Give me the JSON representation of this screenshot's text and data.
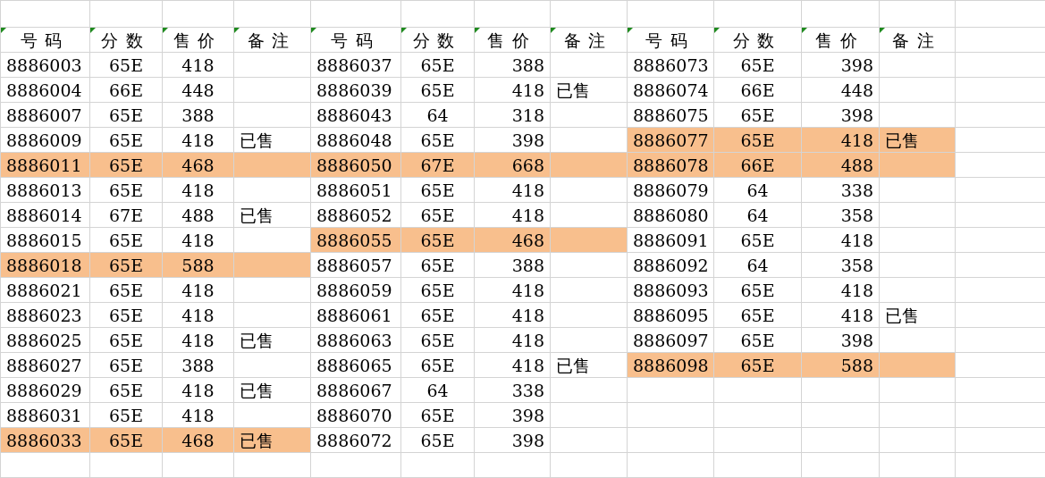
{
  "blocks": [
    {
      "columns": [
        {
          "label": "号码",
          "marked": true
        },
        {
          "label": "分数",
          "marked": true
        },
        {
          "label": "售价",
          "marked": true
        },
        {
          "label": "备注",
          "marked": true
        }
      ],
      "rows": [
        {
          "code": "8886003",
          "score": "65E",
          "price": "418",
          "highlighted": false
        },
        {
          "code": "8886004",
          "score": "66E",
          "price": "448",
          "highlighted": false
        },
        {
          "code": "8886007",
          "score": "65E",
          "price": "388",
          "highlighted": false
        },
        {
          "code": "8886009",
          "score": "65E",
          "price": "418",
          "note": "已售",
          "highlighted": false
        },
        {
          "code": "8886011",
          "score": "65E",
          "price": "468",
          "highlighted": true
        },
        {
          "code": "8886013",
          "score": "65E",
          "price": "418",
          "highlighted": false
        },
        {
          "code": "8886014",
          "score": "67E",
          "price": "488",
          "note": "已售",
          "highlighted": false
        },
        {
          "code": "8886015",
          "score": "65E",
          "price": "418",
          "highlighted": false
        },
        {
          "code": "8886018",
          "score": "65E",
          "price": "588",
          "highlighted": true
        },
        {
          "code": "8886021",
          "score": "65E",
          "price": "418",
          "highlighted": false
        },
        {
          "code": "8886023",
          "score": "65E",
          "price": "418",
          "highlighted": false
        },
        {
          "code": "8886025",
          "score": "65E",
          "price": "418",
          "note": "已售",
          "highlighted": false
        },
        {
          "code": "8886027",
          "score": "65E",
          "price": "388",
          "highlighted": false
        },
        {
          "code": "8886029",
          "score": "65E",
          "price": "418",
          "note": "已售",
          "highlighted": false
        },
        {
          "code": "8886031",
          "score": "65E",
          "price": "418",
          "highlighted": false
        },
        {
          "code": "8886033",
          "score": "65E",
          "price": "468",
          "note": "已售",
          "highlighted": true
        }
      ]
    },
    {
      "columns": [
        {
          "label": "号码",
          "marked": true
        },
        {
          "label": "分数",
          "marked": true
        },
        {
          "label": "售价",
          "marked": true
        },
        {
          "label": "备注",
          "marked": true
        }
      ],
      "rows": [
        {
          "code": "8886037",
          "score": "65E",
          "price": "388",
          "highlighted": false
        },
        {
          "code": "8886039",
          "score": "65E",
          "price": "418",
          "note": "已售",
          "highlighted": false
        },
        {
          "code": "8886043",
          "score": "64",
          "price": "318",
          "highlighted": false
        },
        {
          "code": "8886048",
          "score": "65E",
          "price": "398",
          "highlighted": false
        },
        {
          "code": "8886050",
          "score": "67E",
          "price": "668",
          "highlighted": true
        },
        {
          "code": "8886051",
          "score": "65E",
          "price": "418",
          "highlighted": false
        },
        {
          "code": "8886052",
          "score": "65E",
          "price": "418",
          "highlighted": false
        },
        {
          "code": "8886055",
          "score": "65E",
          "price": "468",
          "highlighted": true
        },
        {
          "code": "8886057",
          "score": "65E",
          "price": "388",
          "highlighted": false
        },
        {
          "code": "8886059",
          "score": "65E",
          "price": "418",
          "highlighted": false
        },
        {
          "code": "8886061",
          "score": "65E",
          "price": "418",
          "highlighted": false
        },
        {
          "code": "8886063",
          "score": "65E",
          "price": "418",
          "highlighted": false
        },
        {
          "code": "8886065",
          "score": "65E",
          "price": "418",
          "note": "已售",
          "highlighted": false
        },
        {
          "code": "8886067",
          "score": "64",
          "price": "338",
          "highlighted": false
        },
        {
          "code": "8886070",
          "score": "65E",
          "price": "398",
          "highlighted": false
        },
        {
          "code": "8886072",
          "score": "65E",
          "price": "398",
          "highlighted": false
        }
      ]
    },
    {
      "columns": [
        {
          "label": "号码",
          "marked": true
        },
        {
          "label": "分数",
          "marked": true
        },
        {
          "label": "售价",
          "marked": true
        },
        {
          "label": "备注",
          "marked": true
        }
      ],
      "rows": [
        {
          "code": "8886073",
          "score": "65E",
          "price": "398",
          "highlighted": false
        },
        {
          "code": "8886074",
          "score": "66E",
          "price": "448",
          "highlighted": false
        },
        {
          "code": "8886075",
          "score": "65E",
          "price": "398",
          "highlighted": false
        },
        {
          "code": "8886077",
          "score": "65E",
          "price": "418",
          "note": "已售",
          "highlighted": true
        },
        {
          "code": "8886078",
          "score": "66E",
          "price": "488",
          "highlighted": true
        },
        {
          "code": "8886079",
          "score": "64",
          "price": "338",
          "highlighted": false
        },
        {
          "code": "8886080",
          "score": "64",
          "price": "358",
          "highlighted": false
        },
        {
          "code": "8886091",
          "score": "65E",
          "price": "418",
          "highlighted": false
        },
        {
          "code": "8886092",
          "score": "64",
          "price": "358",
          "highlighted": false
        },
        {
          "code": "8886093",
          "score": "65E",
          "price": "418",
          "highlighted": false
        },
        {
          "code": "8886095",
          "score": "65E",
          "price": "418",
          "note": "已售",
          "highlighted": false
        },
        {
          "code": "8886097",
          "score": "65E",
          "price": "398",
          "highlighted": false
        },
        {
          "code": "8886098",
          "score": "65E",
          "price": "588",
          "highlighted": true
        }
      ]
    }
  ]
}
